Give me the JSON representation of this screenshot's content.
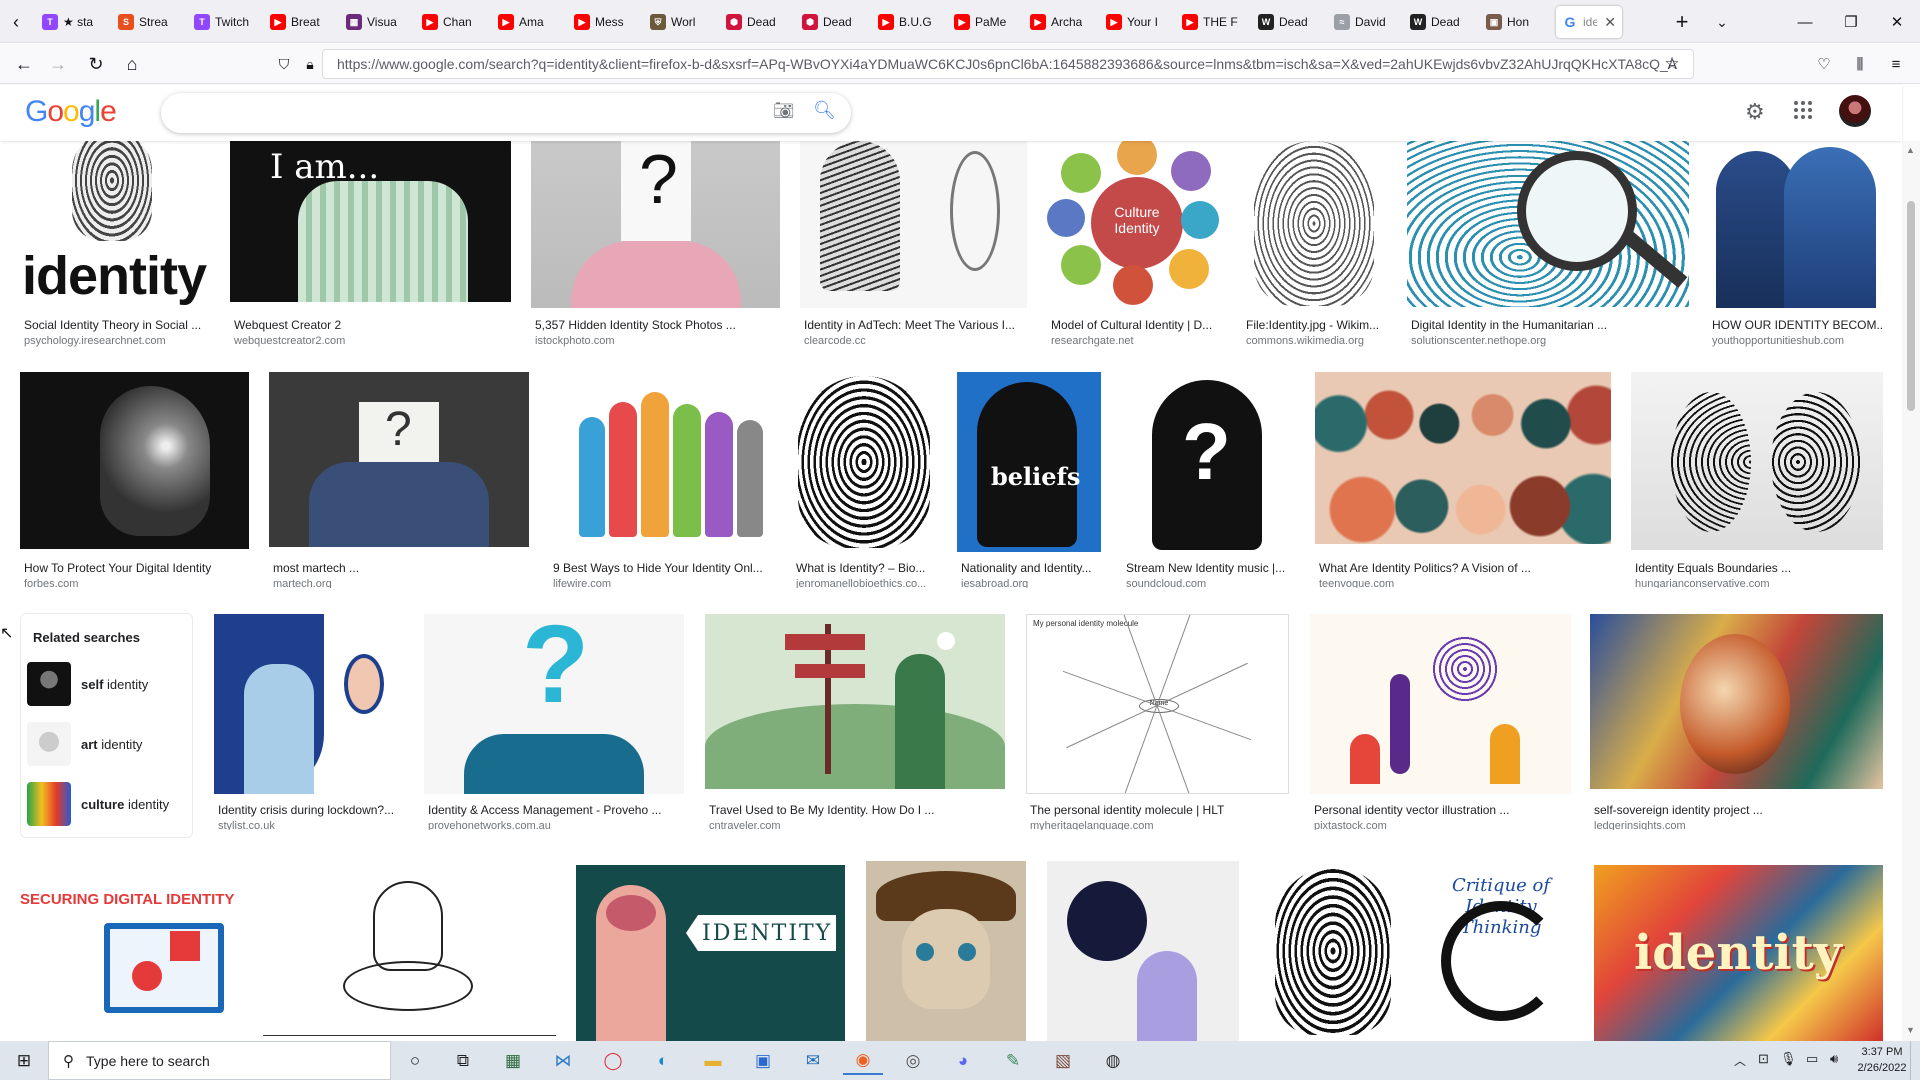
{
  "browser": {
    "tabs": [
      {
        "label": "★ sta",
        "icon": "twitch",
        "color": "#9146ff"
      },
      {
        "label": "Strea",
        "icon": "streamlabs",
        "color": "#e94f1d"
      },
      {
        "label": "Twitch",
        "icon": "twitch",
        "color": "#9146ff"
      },
      {
        "label": "Breat",
        "icon": "youtube",
        "color": "#ff0000"
      },
      {
        "label": "Visua",
        "icon": "film",
        "color": "#6b2a7b"
      },
      {
        "label": "Chan",
        "icon": "youtube",
        "color": "#ff0000"
      },
      {
        "label": "Ama",
        "icon": "youtube",
        "color": "#ff0000"
      },
      {
        "label": "Mess",
        "icon": "youtube",
        "color": "#ff0000"
      },
      {
        "label": "Worl",
        "icon": "shield",
        "color": "#6b5a3a"
      },
      {
        "label": "Dead",
        "icon": "dbd",
        "color": "#d0143e"
      },
      {
        "label": "Dead",
        "icon": "dbd",
        "color": "#d0143e"
      },
      {
        "label": "B.U.G",
        "icon": "youtube",
        "color": "#ff0000"
      },
      {
        "label": "PaMe",
        "icon": "youtube",
        "color": "#ff0000"
      },
      {
        "label": "Archa",
        "icon": "youtube",
        "color": "#ff0000"
      },
      {
        "label": "Your I",
        "icon": "youtube",
        "color": "#ff0000"
      },
      {
        "label": "THE F",
        "icon": "youtube",
        "color": "#ff0000"
      },
      {
        "label": "Dead",
        "icon": "wiki",
        "color": "#222222"
      },
      {
        "label": "David",
        "icon": "lines",
        "color": "#9aa0a6"
      },
      {
        "label": "Dead",
        "icon": "wiki",
        "color": "#222222"
      },
      {
        "label": "Hon",
        "icon": "photo",
        "color": "#7a5a4a"
      }
    ],
    "active_tab": {
      "label": "ide",
      "icon": "google"
    },
    "new_tab": "+",
    "url": "https://www.google.com/search?q=identity&client=firefox-b-d&sxsrf=APq-WBvOYXi4aYDMuaWC6KCJ0s6pnCl6bA:1645882393686&source=lnms&tbm=isch&sa=X&ved=2ahUKEwjds6vbvZ32AhUJrqQKHcXTA8cQ_A"
  },
  "google": {
    "logo": "Google",
    "search_value": "",
    "colors": {
      "blue": "#4285f4",
      "red": "#ea4335",
      "yellow": "#fbbc05",
      "green": "#34a853"
    }
  },
  "results_row1": [
    {
      "caption": "Social Identity Theory in Social ...",
      "source": "psychology.iresearchnet.com",
      "text": "identity"
    },
    {
      "caption": "Webquest Creator 2",
      "source": "webquestcreator2.com",
      "text": "I am..."
    },
    {
      "caption": "5,357 Hidden Identity Stock Photos ...",
      "source": "istockphoto.com",
      "text": "?"
    },
    {
      "caption": "Identity in AdTech: Meet The Various I...",
      "source": "clearcode.cc",
      "text": ""
    },
    {
      "caption": "Model of Cultural Identity | D...",
      "source": "researchgate.net",
      "text": "Culture Identity"
    },
    {
      "caption": "File:Identity.jpg - Wikim...",
      "source": "commons.wikimedia.org",
      "text": ""
    },
    {
      "caption": "Digital Identity in the Humanitarian ...",
      "source": "solutionscenter.nethope.org",
      "text": ""
    },
    {
      "caption": "HOW OUR IDENTITY BECOM...",
      "source": "youthopportunitieshub.com",
      "text": ""
    }
  ],
  "results_row2": [
    {
      "caption": "How To Protect Your Digital Identity",
      "source": "forbes.com"
    },
    {
      "caption": "most martech ...",
      "source": "martech.org"
    },
    {
      "caption": "9 Best Ways to Hide Your Identity Onl...",
      "source": "lifewire.com"
    },
    {
      "caption": "What is Identity? – Bio...",
      "source": "jenromanellobioethics.co..."
    },
    {
      "caption": "Nationality and Identity...",
      "source": "iesabroad.org"
    },
    {
      "caption": "Stream New Identity music |...",
      "source": "soundcloud.com"
    },
    {
      "caption": "What Are Identity Politics? A Vision of ...",
      "source": "teenvogue.com"
    },
    {
      "caption": "Identity Equals Boundaries ...",
      "source": "hungarianconservative.com"
    }
  ],
  "related": {
    "title": "Related searches",
    "items": [
      {
        "bold": "self",
        "rest": " identity"
      },
      {
        "bold": "art",
        "rest": " identity"
      },
      {
        "bold": "culture",
        "rest": " identity"
      }
    ]
  },
  "results_row3": [
    {
      "caption": "Identity crisis during lockdown?...",
      "source": "stylist.co.uk"
    },
    {
      "caption": "Identity & Access Management - Proveho ...",
      "source": "provehonetworks.com.au"
    },
    {
      "caption": "Travel Used to Be My Identity. How Do I ...",
      "source": "cntraveler.com"
    },
    {
      "caption": "The personal identity molecule | HLT",
      "source": "myheritagelanguage.com"
    },
    {
      "caption": "Personal identity vector illustration ...",
      "source": "pixtastock.com"
    },
    {
      "caption": "self-sovereign identity project ...",
      "source": "ledgerinsights.com"
    }
  ],
  "results_row4": [
    {
      "text": "SECURING DIGITAL IDENTITY"
    },
    {
      "text": ""
    },
    {
      "text": "IDENTITY"
    },
    {
      "text": ""
    },
    {
      "text": ""
    },
    {
      "text": ""
    },
    {
      "text": "Critique of Identity Thinking"
    },
    {
      "text": "identity"
    }
  ],
  "taskbar": {
    "search_placeholder": "Type here to search",
    "time": "3:37 PM",
    "date": "2/26/2022"
  }
}
